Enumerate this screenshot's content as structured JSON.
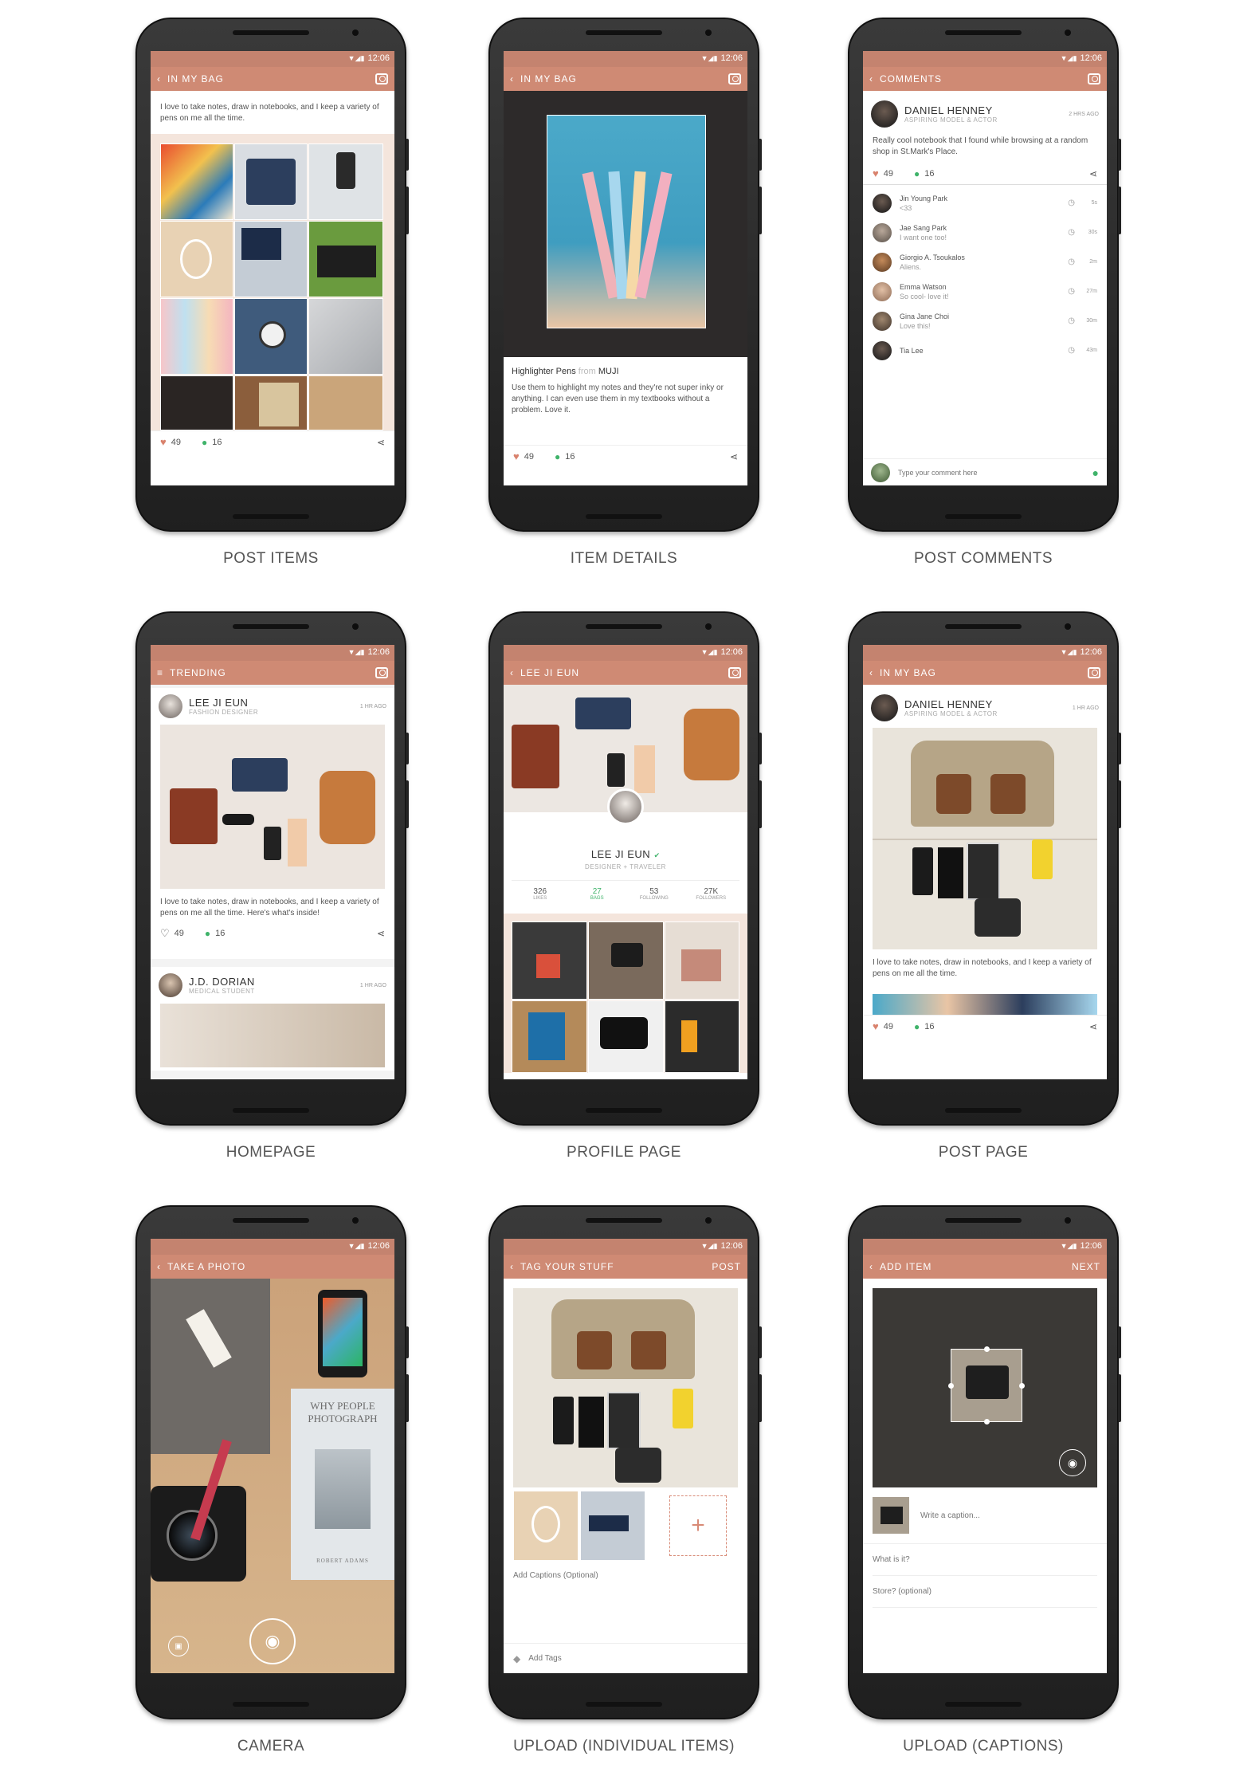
{
  "status": {
    "time": "12:06"
  },
  "screens": {
    "post_items": {
      "label": "POST ITEMS",
      "title": "IN MY BAG",
      "text": "I love to take notes, draw in notebooks, and I keep a variety of pens on me all the time.",
      "likes": "49",
      "comments": "16"
    },
    "item_details": {
      "label": "ITEM DETAILS",
      "title": "IN MY BAG",
      "item_name": "Highlighter Pens",
      "from_word": "from",
      "brand": "MUJI",
      "text": "Use them to highlight my notes and they're not super inky or anything. I can even use them in my textbooks without a problem. Love it.",
      "likes": "49",
      "comments": "16"
    },
    "post_comments": {
      "label": "POST COMMENTS",
      "title": "COMMENTS",
      "user_name": "DANIEL HENNEY",
      "user_role": "ASPIRING MODEL & ACTOR",
      "time": "2 HRS AGO",
      "text": "Really cool notebook that I found while browsing at a random shop in St.Mark's Place.",
      "likes": "49",
      "comments": "16",
      "comment_list": [
        {
          "name": "Jin Young Park",
          "text": "<33",
          "ago": "5s"
        },
        {
          "name": "Jae Sang Park",
          "text": "I want one too!",
          "ago": "30s"
        },
        {
          "name": "Giorgio A. Tsoukalos",
          "text": "Aliens.",
          "ago": "2m"
        },
        {
          "name": "Emma Watson",
          "text": "So cool- love it!",
          "ago": "27m"
        },
        {
          "name": "Gina Jane Choi",
          "text": "Love this!",
          "ago": "30m"
        },
        {
          "name": "Tia Lee",
          "text": "",
          "ago": "43m"
        }
      ],
      "input_placeholder": "Type your comment here"
    },
    "homepage": {
      "label": "HOMEPAGE",
      "title": "TRENDING",
      "post1_user": "LEE JI EUN",
      "post1_role": "FASHION DESIGNER",
      "post1_time": "1 HR AGO",
      "post1_text": "I love to take notes, draw in notebooks, and I keep a variety of pens on me all the time. Here's what's inside!",
      "likes": "49",
      "comments": "16",
      "post2_user": "J.D. DORIAN",
      "post2_role": "MEDICAL STUDENT",
      "post2_time": "1 HR AGO"
    },
    "profile_page": {
      "label": "PROFILE PAGE",
      "title": "LEE JI EUN",
      "name": "LEE JI EUN",
      "role": "DESIGNER + TRAVELER",
      "stats": [
        {
          "value": "326",
          "label": "LIKES"
        },
        {
          "value": "27",
          "label": "BAGS"
        },
        {
          "value": "53",
          "label": "FOLLOWING"
        },
        {
          "value": "27K",
          "label": "FOLLOWERS"
        }
      ]
    },
    "post_page": {
      "label": "POST PAGE",
      "title": "IN MY BAG",
      "user_name": "DANIEL HENNEY",
      "user_role": "ASPIRING MODEL & ACTOR",
      "time": "1 HR AGO",
      "text": "I love to take notes, draw in notebooks, and I keep a variety of pens on me all the time.",
      "likes": "49",
      "comments": "16"
    },
    "camera": {
      "label": "CAMERA",
      "title": "TAKE A PHOTO",
      "book_title": "WHY PEOPLE PHOTOGRAPH",
      "book_author": "ROBERT ADAMS"
    },
    "upload_items": {
      "label": "UPLOAD (INDIVIDUAL ITEMS)",
      "title": "TAG YOUR STUFF",
      "action": "POST",
      "captions_placeholder": "Add Captions (Optional)",
      "tags_placeholder": "Add Tags"
    },
    "upload_captions": {
      "label": "UPLOAD (CAPTIONS)",
      "title": "ADD ITEM",
      "action": "NEXT",
      "caption_placeholder": "Write a caption...",
      "what_placeholder": "What is it?",
      "store_placeholder": "Store? (optional)"
    }
  },
  "colors": {
    "accent": "#cf8a74",
    "status": "#c4836f",
    "green": "#3fb36a"
  }
}
